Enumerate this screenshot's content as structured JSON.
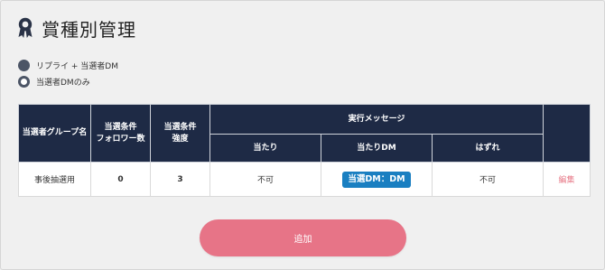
{
  "page": {
    "title": "賞種別管理",
    "title_icon": "award-ribbon-icon"
  },
  "radio_options": [
    {
      "label": "リプライ + 当選者DM",
      "selected": false
    },
    {
      "label": "当選者DMのみ",
      "selected": true
    }
  ],
  "table": {
    "headers": {
      "group_name": "当選者グループ名",
      "follower_count": "当選条件\nフォロワー数",
      "strength": "当選条件\n強度",
      "exec_message": "実行メッセージ",
      "hit": "当たり",
      "hit_dm": "当たりDM",
      "miss": "はずれ"
    },
    "rows": [
      {
        "group_name": "事後抽選用",
        "follower_count": "0",
        "strength": "3",
        "hit": "不可",
        "hit_dm": "当選DM：DM",
        "miss": "不可",
        "edit_label": "編集"
      }
    ]
  },
  "actions": {
    "add_label": "追加"
  },
  "colors": {
    "header_bg": "#1e2a45",
    "badge_bg": "#1a7fc1",
    "accent_pink": "#e77487",
    "radio": "#4c5566"
  }
}
